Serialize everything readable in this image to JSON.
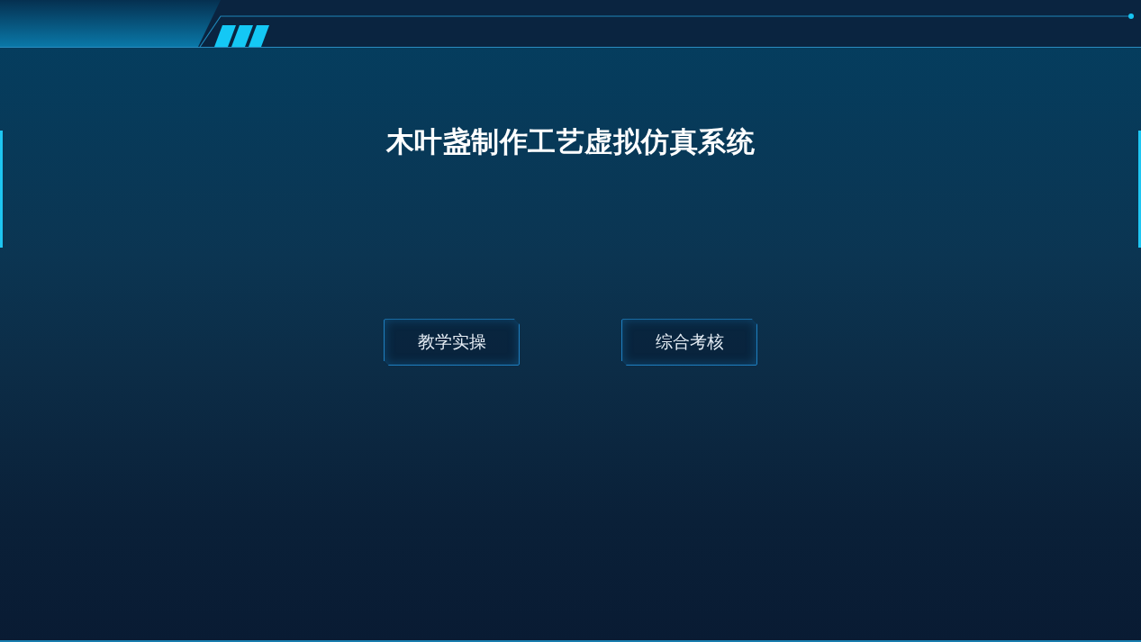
{
  "title": "木叶盏制作工艺虚拟仿真系统",
  "buttons": [
    {
      "label": "教学实操"
    },
    {
      "label": "综合考核"
    }
  ]
}
